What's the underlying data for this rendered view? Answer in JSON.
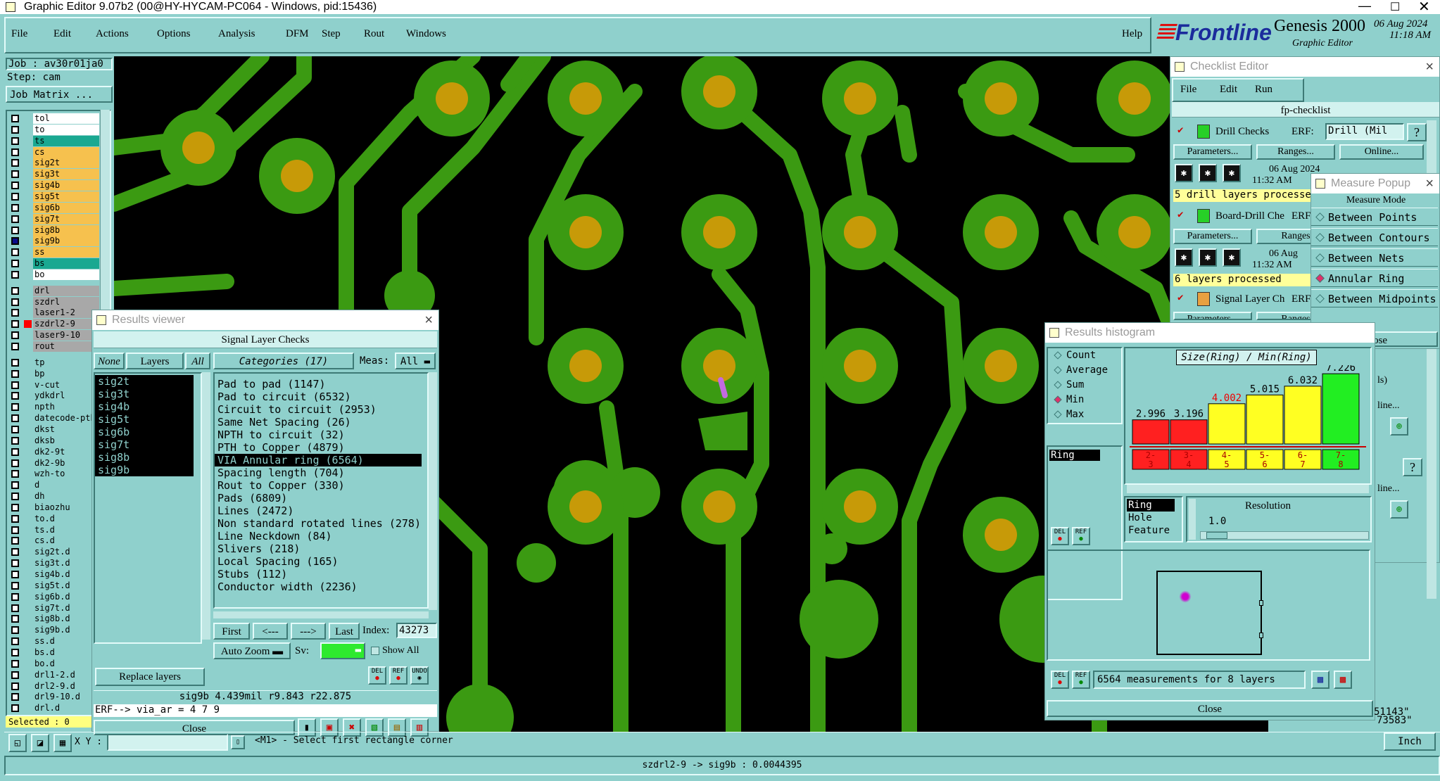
{
  "window": {
    "title": "Graphic Editor 9.07b2 (00@HY-HYCAM-PC064 - Windows, pid:15436)"
  },
  "menu": [
    "File",
    "Edit",
    "Actions",
    "Options",
    "Analysis",
    "DFM",
    "Step",
    "Rout",
    "Windows"
  ],
  "help": "Help",
  "brand": {
    "logo": "Frontline",
    "product": "Genesis 2000",
    "sub": "Graphic Editor",
    "date": "06 Aug 2024",
    "time": "11:18 AM"
  },
  "job": {
    "job": "Job : av30r01ja0",
    "step": "Step: cam",
    "matrix": "Job Matrix ..."
  },
  "layers": [
    {
      "name": "tol",
      "color": "#ffffff"
    },
    {
      "name": "to",
      "color": "#ffffff"
    },
    {
      "name": "ts",
      "color": "#1aa891"
    },
    {
      "name": "cs",
      "color": "#f6c14e"
    },
    {
      "name": "sig2t",
      "color": "#f6c14e"
    },
    {
      "name": "sig3t",
      "color": "#f6c14e"
    },
    {
      "name": "sig4b",
      "color": "#f6c14e"
    },
    {
      "name": "sig5t",
      "color": "#f6c14e"
    },
    {
      "name": "sig6b",
      "color": "#f6c14e"
    },
    {
      "name": "sig7t",
      "color": "#f6c14e"
    },
    {
      "name": "sig8b",
      "color": "#f6c14e"
    },
    {
      "name": "sig9b",
      "color": "#f6c14e"
    },
    {
      "name": "ss",
      "color": "#f6c14e"
    },
    {
      "name": "bs",
      "color": "#1aa891"
    },
    {
      "name": "bo",
      "color": "#ffffff"
    },
    {
      "name": "drl",
      "color": "#a8a8a8"
    },
    {
      "name": "szdrl",
      "color": "#a8a8a8"
    },
    {
      "name": "laser1-2",
      "color": "#a8a8a8"
    },
    {
      "name": "szdrl2-9",
      "color": "#a8a8a8"
    },
    {
      "name": "laser9-10",
      "color": "#a8a8a8"
    },
    {
      "name": "rout",
      "color": "#a8a8a8"
    },
    {
      "name": "tp",
      "color": "#8fd0cc"
    },
    {
      "name": "bp",
      "color": "#8fd0cc"
    },
    {
      "name": "v-cut",
      "color": "#8fd0cc"
    },
    {
      "name": "ydkdrl",
      "color": "#8fd0cc"
    },
    {
      "name": "npth",
      "color": "#8fd0cc"
    },
    {
      "name": "datecode-pth",
      "color": "#8fd0cc"
    },
    {
      "name": "dkst",
      "color": "#8fd0cc"
    },
    {
      "name": "dksb",
      "color": "#8fd0cc"
    },
    {
      "name": "dk2-9t",
      "color": "#8fd0cc"
    },
    {
      "name": "dk2-9b",
      "color": "#8fd0cc"
    },
    {
      "name": "wzh-to",
      "color": "#8fd0cc"
    },
    {
      "name": "d",
      "color": "#8fd0cc"
    },
    {
      "name": "dh",
      "color": "#8fd0cc"
    },
    {
      "name": "biaozhu",
      "color": "#8fd0cc"
    },
    {
      "name": "to.d",
      "color": "#8fd0cc"
    },
    {
      "name": "ts.d",
      "color": "#8fd0cc"
    },
    {
      "name": "cs.d",
      "color": "#8fd0cc"
    },
    {
      "name": "sig2t.d",
      "color": "#8fd0cc"
    },
    {
      "name": "sig3t.d",
      "color": "#8fd0cc"
    },
    {
      "name": "sig4b.d",
      "color": "#8fd0cc"
    },
    {
      "name": "sig5t.d",
      "color": "#8fd0cc"
    },
    {
      "name": "sig6b.d",
      "color": "#8fd0cc"
    },
    {
      "name": "sig7t.d",
      "color": "#8fd0cc"
    },
    {
      "name": "sig8b.d",
      "color": "#8fd0cc"
    },
    {
      "name": "sig9b.d",
      "color": "#8fd0cc"
    },
    {
      "name": "ss.d",
      "color": "#8fd0cc"
    },
    {
      "name": "bs.d",
      "color": "#8fd0cc"
    },
    {
      "name": "bo.d",
      "color": "#8fd0cc"
    },
    {
      "name": "drl1-2.d",
      "color": "#8fd0cc"
    },
    {
      "name": "drl2-9.d",
      "color": "#8fd0cc"
    },
    {
      "name": "drl9-10.d",
      "color": "#8fd0cc"
    },
    {
      "name": "drl.d",
      "color": "#8fd0cc"
    }
  ],
  "selected": "Selected : 0",
  "results_viewer": {
    "title": "Results viewer",
    "header": "Signal Layer Checks",
    "none": "None",
    "layers_btn": "Layers",
    "all": "All",
    "categories_btn": "Categories (17)",
    "meas_label": "Meas:",
    "meas_value": "All",
    "layers": [
      "sig2t",
      "sig3t",
      "sig4b",
      "sig5t",
      "sig6b",
      "sig7t",
      "sig8b",
      "sig9b"
    ],
    "categories": [
      "Pad to pad (1147)",
      "Pad to circuit (6532)",
      "Circuit to circuit (2953)",
      "Same Net Spacing (26)",
      "NPTH to circuit (32)",
      "PTH to Copper (4879)",
      "VIA Annular ring (6564)",
      "Spacing length (704)",
      "Rout to Copper (330)",
      "Pads (6809)",
      "Lines (2472)",
      "Non standard rotated lines (278)",
      "Line Neckdown (84)",
      "Slivers (218)",
      "Local Spacing (165)",
      "Stubs (112)",
      "Conductor width (2236)"
    ],
    "first": "First",
    "prev": "<---",
    "next": "--->",
    "last": "Last",
    "index_label": "Index:",
    "index_value": "43273",
    "auto_zoom": "Auto Zoom",
    "sv": "Sv:",
    "show_all": "Show All",
    "replace_layers": "Replace layers",
    "del": "DEL",
    "ref": "REF",
    "undo": "UNDO",
    "status": "sig9b 4.439mil  r9.843  r22.875",
    "erf": "ERF--> via_ar = 4 7 9",
    "close": "Close"
  },
  "checklist": {
    "title": "Checklist Editor",
    "menu": [
      "File",
      "Edit",
      "Run"
    ],
    "name": "fp-checklist",
    "items": [
      {
        "label": "Drill Checks",
        "erf": "ERF:",
        "erf_value": "Drill (Mil",
        "params": "Parameters...",
        "ranges": "Ranges...",
        "online": "Online...",
        "date": "06 Aug 2024",
        "time": "11:32 AM",
        "status": "5 drill layers processed"
      },
      {
        "label": "Board-Drill Che",
        "erf": "ERF",
        "params": "Parameters...",
        "ranges": "Ranges",
        "date": "06 Aug",
        "time": "11:32 AM",
        "status": "6 layers processed"
      },
      {
        "label": "Signal Layer Ch",
        "erf": "ERF",
        "params": "Parameters...",
        "ranges": "Ranges"
      }
    ],
    "right_fragments": [
      "ls)",
      "line...",
      "line..."
    ]
  },
  "measure": {
    "title": "Measure Popup",
    "mode_label": "Measure Mode",
    "modes": [
      "Between Points",
      "Between Contours",
      "Between Nets",
      "Annular Ring",
      "Between Midpoints"
    ],
    "selected_mode": "Annular Ring",
    "close": "Close"
  },
  "histogram": {
    "title": "Results histogram",
    "stats": [
      "Count",
      "Average",
      "Sum",
      "Min",
      "Max"
    ],
    "selected_stat": "Min",
    "field": "Ring",
    "chart_title": "Size(Ring) / Min(Ring)",
    "bars": [
      {
        "value": "2.996",
        "label": "2-3",
        "color": "#ff2020",
        "height": 0.33
      },
      {
        "value": "3.196",
        "label": "3-4",
        "color": "#ff2020",
        "height": 0.33
      },
      {
        "value": "4.002",
        "label": "4-5",
        "color": "#ffff22",
        "height": 0.55
      },
      {
        "value": "5.015",
        "label": "5-6",
        "color": "#ffff22",
        "height": 0.67
      },
      {
        "value": "6.032",
        "label": "6-7",
        "color": "#ffff22",
        "height": 0.79
      },
      {
        "value": "7.226",
        "label": "7-8",
        "color": "#22ee22",
        "height": 0.96
      }
    ],
    "attributes": [
      "Ring",
      "Hole",
      "Feature"
    ],
    "resolution_label": "Resolution",
    "resolution": "1.0",
    "summary": "6564 measurements for 8 layers",
    "close": "Close",
    "del": "DEL",
    "ref": "REF"
  },
  "status_bar": {
    "xy": "X Y :",
    "prompt": "<M1> - Select first rectangle corner",
    "units": "Inch",
    "coord1": "51143\"",
    "coord2": "73583\"",
    "measure": "szdrl2-9 -> sig9b : 0.0044395"
  },
  "colors": {
    "bg": "#8fd0cc",
    "pcb_bg": "#000000",
    "copper": "#3b9a12",
    "drill": "#c79a08"
  }
}
